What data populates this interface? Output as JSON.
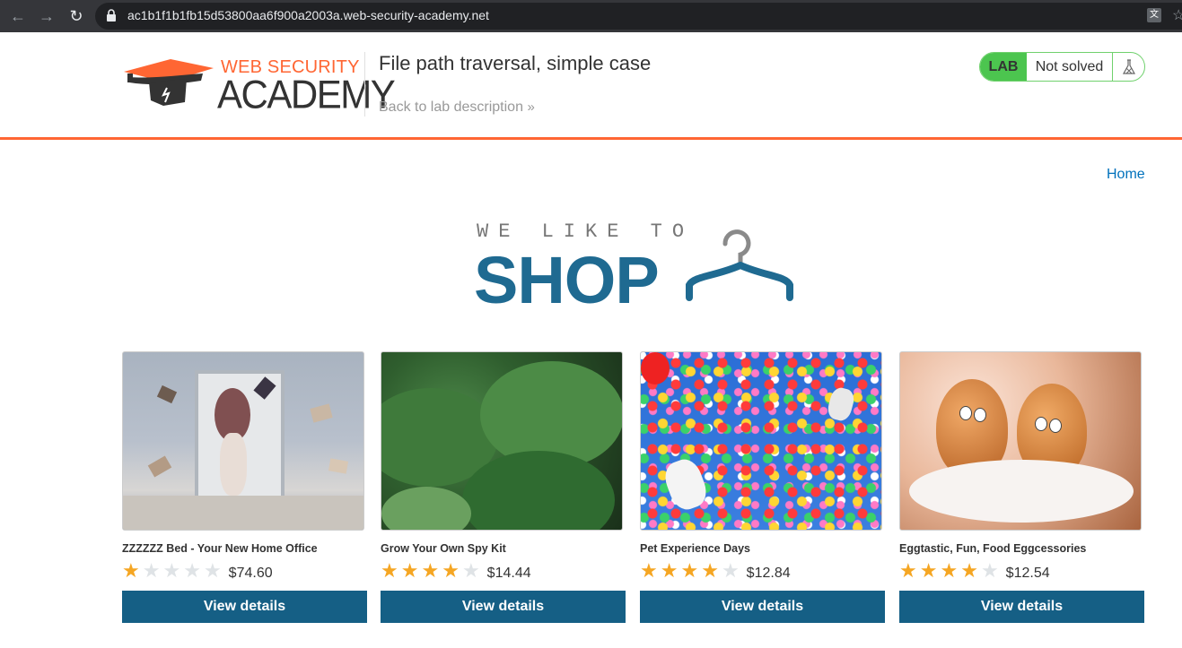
{
  "browser": {
    "url": "ac1b1f1b1fb15d53800aa6f900a2003a.web-security-academy.net"
  },
  "header": {
    "logo_line1": "WEB SECURITY",
    "logo_line2": "ACADEMY",
    "lab_title": "File path traversal, simple case",
    "back_link": "Back to lab description",
    "lab_badge": "LAB",
    "lab_status": "Not solved"
  },
  "nav": {
    "home": "Home"
  },
  "banner": {
    "top": "WE LIKE TO",
    "shop": "SHOP"
  },
  "products": [
    {
      "title": "ZZZZZZ Bed - Your New Home Office",
      "rating": 1,
      "price": "$74.60",
      "button": "View details"
    },
    {
      "title": "Grow Your Own Spy Kit",
      "rating": 4,
      "price": "$14.44",
      "button": "View details"
    },
    {
      "title": "Pet Experience Days",
      "rating": 4,
      "price": "$12.84",
      "button": "View details"
    },
    {
      "title": "Eggtastic, Fun, Food Eggcessories",
      "rating": 4,
      "price": "$12.54",
      "button": "View details"
    }
  ],
  "colors": {
    "accent_orange": "#ff6633",
    "brand_blue": "#155f85",
    "star_filled": "#f5a623",
    "star_empty": "#dfe3e6",
    "lab_green": "#4cc54f"
  }
}
